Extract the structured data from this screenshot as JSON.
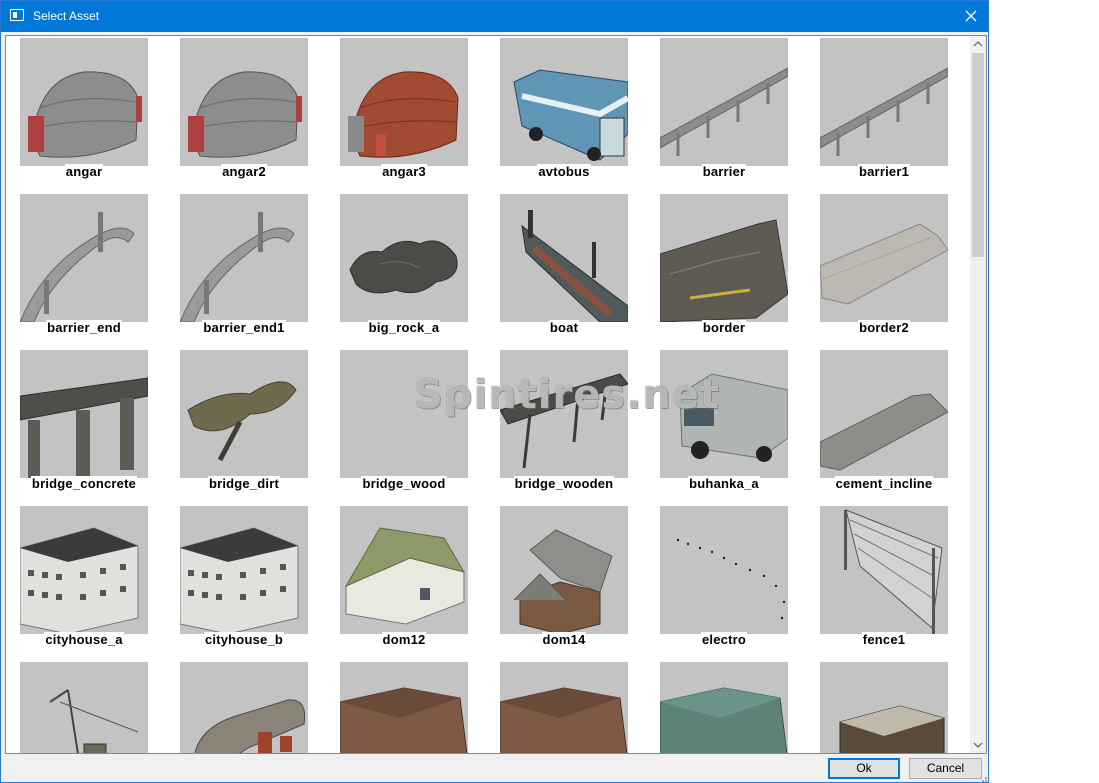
{
  "window": {
    "title": "Select Asset"
  },
  "watermark": "Spintires.net",
  "assets": [
    {
      "name": "angar",
      "icon": "hangar-icon"
    },
    {
      "name": "angar2",
      "icon": "hangar-icon"
    },
    {
      "name": "angar3",
      "icon": "hangar-rusty-icon"
    },
    {
      "name": "avtobus",
      "icon": "bus-icon"
    },
    {
      "name": "barrier",
      "icon": "guardrail-icon"
    },
    {
      "name": "barrier1",
      "icon": "guardrail-icon"
    },
    {
      "name": "barrier_end",
      "icon": "guardrail-end-icon"
    },
    {
      "name": "barrier_end1",
      "icon": "guardrail-end-icon"
    },
    {
      "name": "big_rock_a",
      "icon": "rock-icon"
    },
    {
      "name": "boat",
      "icon": "boat-icon"
    },
    {
      "name": "border",
      "icon": "rubble-wall-icon"
    },
    {
      "name": "border2",
      "icon": "concrete-barrier-icon"
    },
    {
      "name": "bridge_concrete",
      "icon": "concrete-bridge-icon"
    },
    {
      "name": "bridge_dirt",
      "icon": "dirt-bridge-icon"
    },
    {
      "name": "bridge_wood",
      "icon": "empty-icon"
    },
    {
      "name": "bridge_wooden",
      "icon": "wooden-bridge-icon"
    },
    {
      "name": "buhanka_a",
      "icon": "van-icon"
    },
    {
      "name": "cement_incline",
      "icon": "ramp-icon"
    },
    {
      "name": "cityhouse_a",
      "icon": "apartment-block-icon"
    },
    {
      "name": "cityhouse_b",
      "icon": "apartment-block-icon"
    },
    {
      "name": "dom12",
      "icon": "house-icon"
    },
    {
      "name": "dom14",
      "icon": "cottage-icon"
    },
    {
      "name": "electro",
      "icon": "power-line-icon"
    },
    {
      "name": "fence1",
      "icon": "mesh-fence-icon"
    },
    {
      "name": "",
      "icon": "crane-icon"
    },
    {
      "name": "",
      "icon": "tank-icon"
    },
    {
      "name": "",
      "icon": "garage-icon"
    },
    {
      "name": "",
      "icon": "garage-icon"
    },
    {
      "name": "",
      "icon": "garage-green-icon"
    },
    {
      "name": "",
      "icon": "foundation-icon"
    }
  ],
  "buttons": {
    "ok": "Ok",
    "cancel": "Cancel"
  },
  "colors": {
    "titlebar": "#0078d7",
    "tile_bg": "#c3c3c3",
    "accent": "#0078d7"
  }
}
